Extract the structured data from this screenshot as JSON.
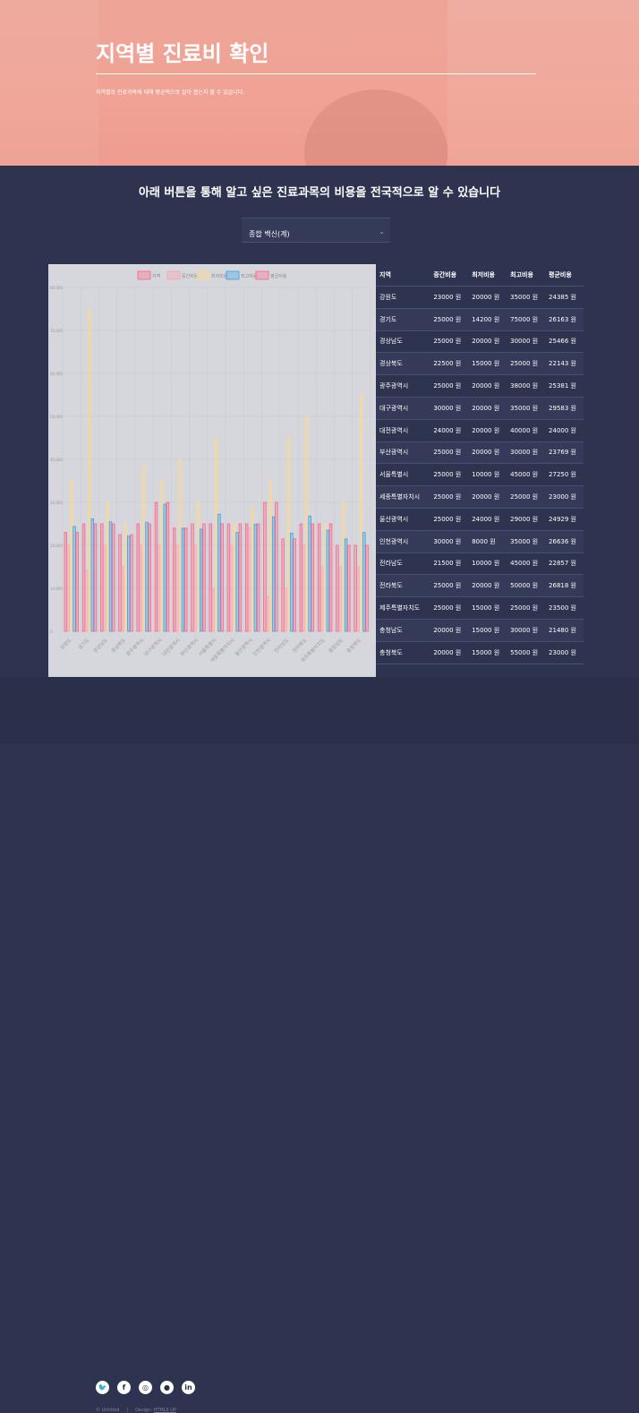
{
  "banner": {
    "title": "지역별 진료비 확인",
    "subtitle": "지역별로 진료과목에 대해 평균적으로 알아 봅는지 할 수 있습니다."
  },
  "section": {
    "title": "아래 버튼을 통해 알고 싶은 진료과목의 비용을 전국적으로 알 수 있습니다"
  },
  "select": {
    "value": "종합 백신(계)"
  },
  "table": {
    "headers": [
      "지역",
      "중간비용",
      "최저비용",
      "최고비용",
      "평균비용"
    ],
    "rows": [
      [
        "강원도",
        "23000 원",
        "20000 원",
        "35000 원",
        "24385 원"
      ],
      [
        "경기도",
        "25000 원",
        "14200 원",
        "75000 원",
        "26163 원"
      ],
      [
        "경상남도",
        "25000 원",
        "20000 원",
        "30000 원",
        "25466 원"
      ],
      [
        "경상북도",
        "22500 원",
        "15000 원",
        "25000 원",
        "22143 원"
      ],
      [
        "광주광역시",
        "25000 원",
        "20000 원",
        "38000 원",
        "25381 원"
      ],
      [
        "대구광역시",
        "30000 원",
        "20000 원",
        "35000 원",
        "29583 원"
      ],
      [
        "대전광역시",
        "24000 원",
        "20000 원",
        "40000 원",
        "24000 원"
      ],
      [
        "부산광역시",
        "25000 원",
        "20000 원",
        "30000 원",
        "23769 원"
      ],
      [
        "서울특별시",
        "25000 원",
        "10000 원",
        "45000 원",
        "27250 원"
      ],
      [
        "세종특별자치시",
        "25000 원",
        "20000 원",
        "25000 원",
        "23000 원"
      ],
      [
        "울산광역시",
        "25000 원",
        "24000 원",
        "29000 원",
        "24929 원"
      ],
      [
        "인천광역시",
        "30000 원",
        "8000 원",
        "35000 원",
        "26636 원"
      ],
      [
        "전라남도",
        "21500 원",
        "10000 원",
        "45000 원",
        "22857 원"
      ],
      [
        "전라북도",
        "25000 원",
        "20000 원",
        "50000 원",
        "26818 원"
      ],
      [
        "제주특별자치도",
        "25000 원",
        "15000 원",
        "25000 원",
        "23500 원"
      ],
      [
        "충청남도",
        "20000 원",
        "15000 원",
        "30000 원",
        "21480 원"
      ],
      [
        "충청북도",
        "20000 원",
        "15000 원",
        "55000 원",
        "23000 원"
      ]
    ]
  },
  "chart_data": {
    "type": "bar",
    "categories": [
      "강원도",
      "경기도",
      "경상남도",
      "경상북도",
      "광주광역시",
      "대구광역시",
      "대전광역시",
      "부산광역시",
      "서울특별시",
      "세종특별자치시",
      "울산광역시",
      "인천광역시",
      "전라남도",
      "전라북도",
      "제주특별자치도",
      "충청남도",
      "충청북도"
    ],
    "series": [
      {
        "name": "지역",
        "color": "#ff6384",
        "values": [
          23000,
          25000,
          25000,
          22500,
          25000,
          30000,
          24000,
          25000,
          25000,
          25000,
          25000,
          30000,
          21500,
          25000,
          25000,
          20000,
          20000
        ]
      },
      {
        "name": "중간비용",
        "color": "#ff9fb1",
        "values": [
          20000,
          14200,
          20000,
          15000,
          20000,
          20000,
          20000,
          20000,
          10000,
          20000,
          24000,
          8000,
          10000,
          20000,
          15000,
          15000,
          15000
        ]
      },
      {
        "name": "최저비용",
        "color": "#ffd98a",
        "values": [
          35000,
          75000,
          30000,
          25000,
          38000,
          35000,
          40000,
          30000,
          45000,
          25000,
          29000,
          35000,
          45000,
          50000,
          25000,
          30000,
          55000
        ]
      },
      {
        "name": "최고비용",
        "color": "#36a2eb",
        "values": [
          24385,
          26163,
          25466,
          22143,
          25381,
          29583,
          24000,
          23769,
          27250,
          23000,
          24929,
          26636,
          22857,
          26818,
          23500,
          21480,
          23000
        ]
      },
      {
        "name": "평균비용",
        "color": "#ff6384",
        "values": [
          23000,
          25000,
          25000,
          22500,
          25000,
          30000,
          24000,
          25000,
          25000,
          25000,
          25000,
          30000,
          21500,
          25000,
          25000,
          20000,
          20000
        ]
      }
    ],
    "ylim": [
      0,
      80000
    ],
    "yticks": [
      "0",
      "10,000",
      "20,000",
      "30,000",
      "40,000",
      "50,000",
      "60,000",
      "70,000",
      "80,000"
    ],
    "legend": "top",
    "grid": true
  },
  "footer": {
    "icons": [
      "twitter-icon",
      "facebook-icon",
      "instagram-icon",
      "github-icon",
      "linkedin-icon"
    ],
    "icon_glyphs": [
      "🐦",
      "f",
      "◎",
      "●",
      "in"
    ],
    "copyright": "© Untitled",
    "design_label": "Design:",
    "design_link": "HTML5 UP"
  }
}
